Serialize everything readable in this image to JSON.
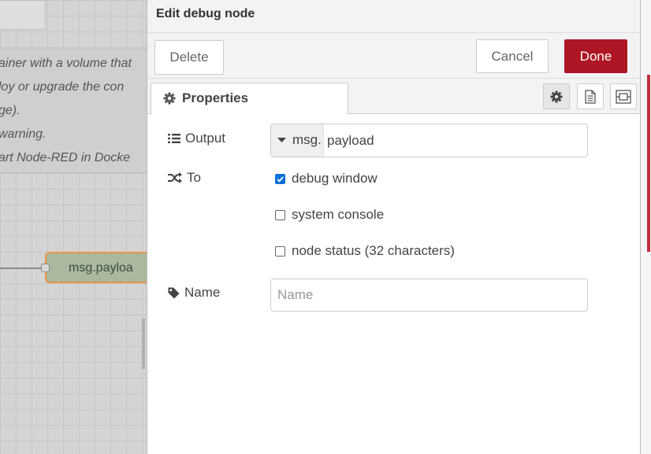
{
  "workspace": {
    "comment_lines": [
      "ainer with a volume that",
      "loy or upgrade the con",
      "ge).",
      "warning.",
      "art Node-RED in Docke"
    ],
    "node_label": "msg.payloa"
  },
  "tray": {
    "title": "Edit debug node",
    "toolbar": {
      "delete_label": "Delete",
      "cancel_label": "Cancel",
      "done_label": "Done"
    },
    "tabs": {
      "properties_label": "Properties",
      "side_tabs": [
        "settings-icon",
        "description-icon",
        "appearance-icon"
      ]
    },
    "form": {
      "output": {
        "label": "Output",
        "type_prefix": "msg.",
        "value": "payload"
      },
      "to": {
        "label": "To",
        "options": [
          {
            "label": "debug window",
            "checked": true
          },
          {
            "label": "system console",
            "checked": false
          },
          {
            "label": "node status (32 characters)",
            "checked": false
          }
        ]
      },
      "name": {
        "label": "Name",
        "placeholder": "Name",
        "value": ""
      }
    }
  },
  "colors": {
    "done_button": "#ad1625",
    "checkbox_checked": "#0b6fd6",
    "node_fill": "#a9b89e",
    "node_border": "#e8954a"
  }
}
